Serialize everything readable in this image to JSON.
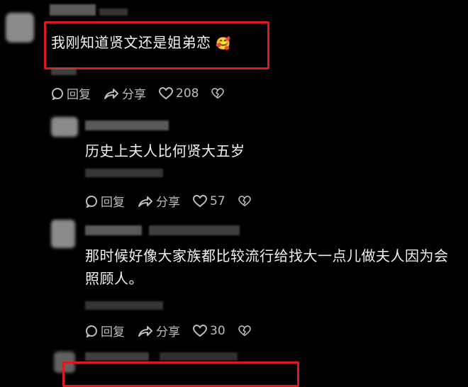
{
  "comments": [
    {
      "text": "我刚知道贤文还是姐弟恋",
      "emoji": "🥰",
      "reply_label": "回复",
      "share_label": "分享",
      "like_count": "208"
    },
    {
      "text": "历史上夫人比何贤大五岁",
      "reply_label": "回复",
      "share_label": "分享",
      "like_count": "57"
    },
    {
      "text_line1": "那时候好像大家族都比较流行给找大一点儿做夫人因为会",
      "text_line2": "照顾人。",
      "reply_label": "回复",
      "share_label": "分享",
      "like_count": "30"
    }
  ],
  "colors": {
    "highlight": "#e0181e",
    "text": "#f2f2f2",
    "muted": "#bcbcbc",
    "background": "#000000"
  }
}
